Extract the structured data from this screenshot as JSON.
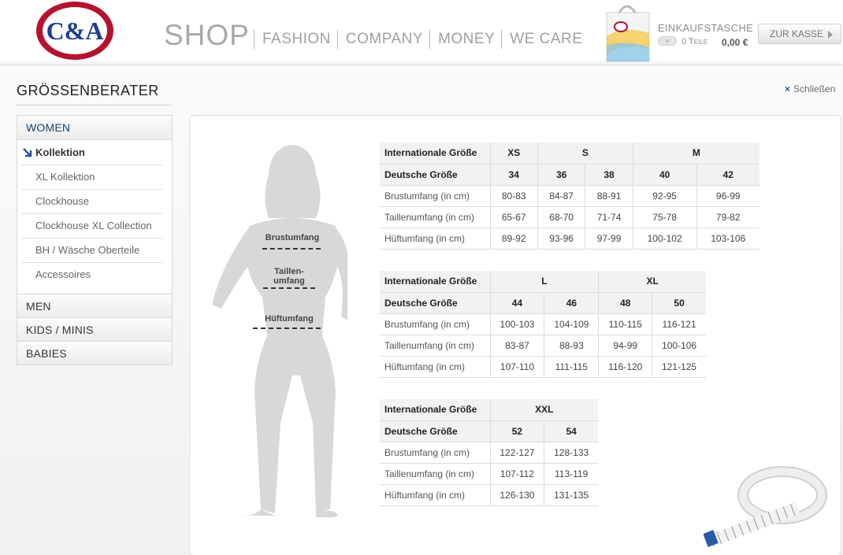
{
  "header": {
    "logo_text": "C&A",
    "shop": "SHOP",
    "nav": [
      "FASHION",
      "COMPANY",
      "MONEY",
      "WE CARE"
    ],
    "bag_title": "EINKAUFSTASCHE",
    "bag_items": "0 Teile",
    "bag_sum": "0,00 €",
    "checkout_label": "ZUR KASSE"
  },
  "page": {
    "title": "GRÖSSENBERATER",
    "close_label": "Schließen"
  },
  "sidenav": {
    "categories": [
      "WOMEN",
      "MEN",
      "KIDS / MINIS",
      "BABIES"
    ],
    "women_sub": [
      "Kollektion",
      "XL Kollektion",
      "Clockhouse",
      "Clockhouse XL Collection",
      "BH / Wäsche Oberteile",
      "Accessoires"
    ],
    "active_sub": "Kollektion"
  },
  "figure": {
    "bust": "Brustumfang",
    "waist_line1": "Taillen-",
    "waist_line2": "umfang",
    "hip": "Hüftumfang"
  },
  "tables": {
    "row_labels": {
      "intl": "Internationale Größe",
      "de": "Deutsche Größe",
      "bust": "Brustumfang (in cm)",
      "waist": "Taillenumfang (in cm)",
      "hip": "Hüftumfang (in cm)"
    },
    "t1": {
      "intl": [
        "XS",
        "S",
        "M"
      ],
      "de": [
        "34",
        "36",
        "38",
        "40",
        "42"
      ],
      "bust": [
        "80-83",
        "84-87",
        "88-91",
        "92-95",
        "96-99"
      ],
      "waist": [
        "65-67",
        "68-70",
        "71-74",
        "75-78",
        "79-82"
      ],
      "hip": [
        "89-92",
        "93-96",
        "97-99",
        "100-102",
        "103-106"
      ]
    },
    "t2": {
      "intl": [
        "L",
        "XL"
      ],
      "de": [
        "44",
        "46",
        "48",
        "50"
      ],
      "bust": [
        "100-103",
        "104-109",
        "110-115",
        "116-121"
      ],
      "waist": [
        "83-87",
        "88-93",
        "94-99",
        "100-106"
      ],
      "hip": [
        "107-110",
        "111-115",
        "116-120",
        "121-125"
      ]
    },
    "t3": {
      "intl": [
        "XXL"
      ],
      "de": [
        "52",
        "54"
      ],
      "bust": [
        "122-127",
        "128-133"
      ],
      "waist": [
        "107-112",
        "113-119"
      ],
      "hip": [
        "126-130",
        "131-135"
      ]
    }
  },
  "colors": {
    "logo_red": "#b5122e",
    "logo_blue": "#1b3f8f",
    "nav_accent": "#16406b"
  }
}
